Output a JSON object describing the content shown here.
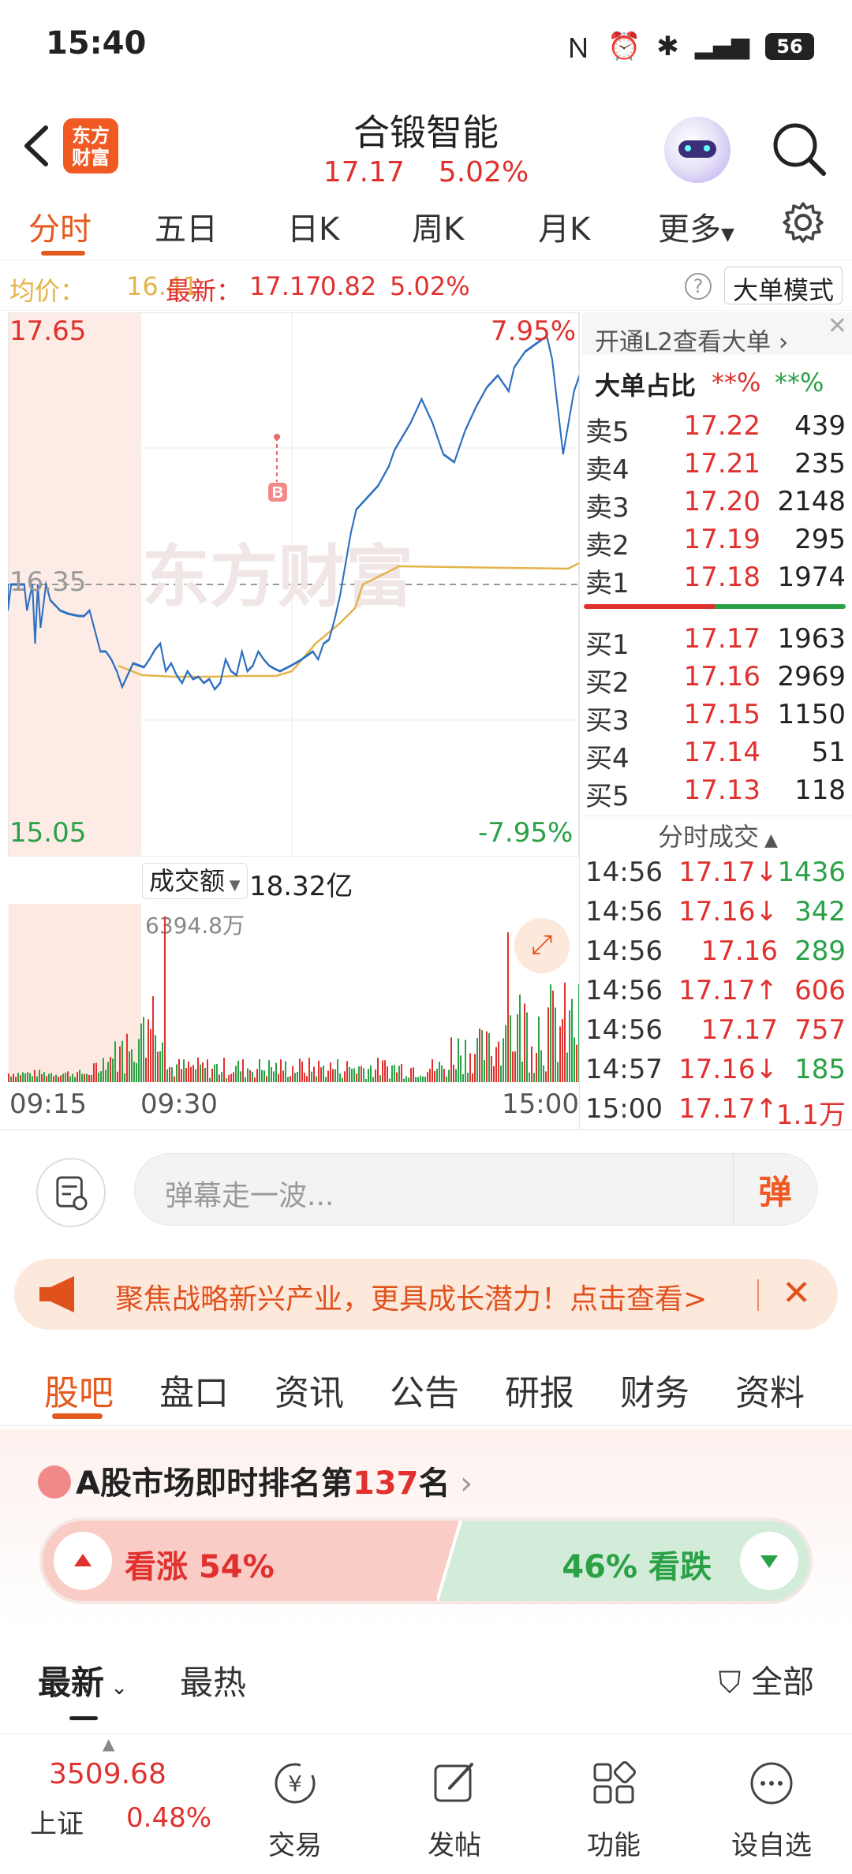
{
  "status": {
    "time": "15:40",
    "battery": "56"
  },
  "header": {
    "title": "合锻智能",
    "price": "17.17",
    "change_pct": "5.02%",
    "logo_line1": "东方",
    "logo_line2": "财富"
  },
  "chart_tabs": [
    "分时",
    "五日",
    "日K",
    "周K",
    "月K",
    "更多"
  ],
  "summary": {
    "avg_label": "均价：",
    "avg_value": "16.41",
    "latest_label": "最新：",
    "latest_value": "17.17",
    "change": "0.82",
    "change_pct": "5.02%",
    "mode_button": "大单模式"
  },
  "chart_labels": {
    "top_price": "17.65",
    "top_pct": "7.95%",
    "mid_price": "16.35",
    "bottom_price": "15.05",
    "bottom_pct": "-7.95%",
    "marker": "B",
    "watermark": "东方财富"
  },
  "volume": {
    "selector": "成交额",
    "total": "18.32亿",
    "max_label": "6394.8万",
    "time_start": "09:15",
    "time_open": "09:30",
    "time_end": "15:00"
  },
  "order_book": {
    "l2_promo": "开通L2查看大单 ›",
    "big_ratio_label": "大单占比",
    "big_ratio_sell": "**%",
    "big_ratio_buy": "**%",
    "asks": [
      {
        "label": "卖5",
        "price": "17.22",
        "vol": "439"
      },
      {
        "label": "卖4",
        "price": "17.21",
        "vol": "235"
      },
      {
        "label": "卖3",
        "price": "17.20",
        "vol": "2148"
      },
      {
        "label": "卖2",
        "price": "17.19",
        "vol": "295"
      },
      {
        "label": "卖1",
        "price": "17.18",
        "vol": "1974"
      }
    ],
    "bids": [
      {
        "label": "买1",
        "price": "17.17",
        "vol": "1963"
      },
      {
        "label": "买2",
        "price": "17.16",
        "vol": "2969"
      },
      {
        "label": "买3",
        "price": "17.15",
        "vol": "1150"
      },
      {
        "label": "买4",
        "price": "17.14",
        "vol": "51"
      },
      {
        "label": "买5",
        "price": "17.13",
        "vol": "118"
      }
    ]
  },
  "trades_title": "分时成交",
  "trades": [
    {
      "time": "14:56",
      "price": "17.17↓",
      "vol": "1436",
      "price_color": "#e0312f",
      "vol_color": "#2aa146"
    },
    {
      "time": "14:56",
      "price": "17.16↓",
      "vol": "342",
      "price_color": "#e0312f",
      "vol_color": "#2aa146"
    },
    {
      "time": "14:56",
      "price": "17.16",
      "vol": "289",
      "price_color": "#e0312f",
      "vol_color": "#2aa146"
    },
    {
      "time": "14:56",
      "price": "17.17↑",
      "vol": "606",
      "price_color": "#e0312f",
      "vol_color": "#e0312f"
    },
    {
      "time": "14:56",
      "price": "17.17",
      "vol": "757",
      "price_color": "#e0312f",
      "vol_color": "#e0312f"
    },
    {
      "time": "14:57",
      "price": "17.16↓",
      "vol": "185",
      "price_color": "#e0312f",
      "vol_color": "#2aa146"
    },
    {
      "time": "15:00",
      "price": "17.17↑",
      "vol": "1.1万",
      "price_color": "#e0312f",
      "vol_color": "#e0312f"
    }
  ],
  "danmaku": {
    "placeholder": "弹幕走一波...",
    "button": "弹"
  },
  "banner": {
    "text": "聚焦战略新兴产业，更具成长潜力！点击查看>"
  },
  "section_tabs": [
    "股吧",
    "盘口",
    "资讯",
    "公告",
    "研报",
    "财务",
    "资料"
  ],
  "ranking": {
    "prefix": "A股市场即时排名第",
    "rank": "137",
    "suffix": "名"
  },
  "sentiment": {
    "up_label": "看涨 54%",
    "down_label": "46% 看跌",
    "up_pct": 54,
    "down_pct": 46
  },
  "sort": {
    "latest": "最新",
    "hot": "最热",
    "filter": "全部"
  },
  "bottom_bar": {
    "index_value": "3509.68",
    "index_name": "上证",
    "index_change": "0.48%",
    "items": [
      "交易",
      "发帖",
      "功能",
      "设自选"
    ]
  },
  "colors": {
    "up": "#e0312f",
    "down": "#2aa146",
    "accent": "#e45a1e",
    "price_line": "#2d6fc0",
    "avg_line": "#e4b34a"
  }
}
